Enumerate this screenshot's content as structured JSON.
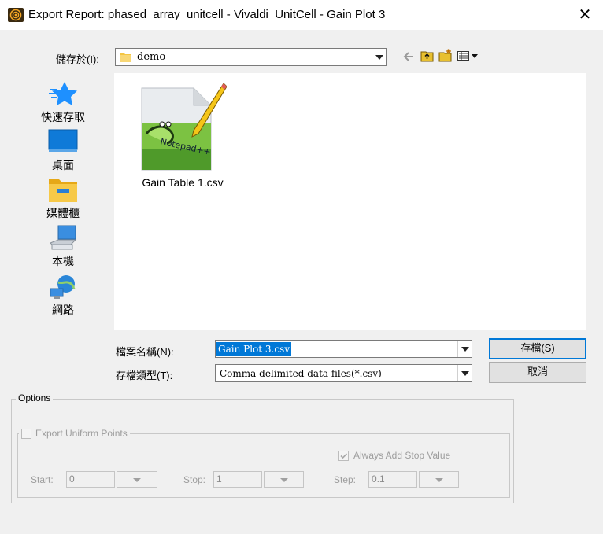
{
  "window": {
    "title": "Export Report: phased_array_unitcell - Vivaldi_UnitCell - Gain Plot 3",
    "close_glyph": "✕"
  },
  "save_in": {
    "label": "儲存於(I):",
    "value": "demo"
  },
  "places": [
    {
      "label": "快速存取",
      "icon": "star-icon"
    },
    {
      "label": "桌面",
      "icon": "desktop-icon"
    },
    {
      "label": "媒體櫃",
      "icon": "library-folder-icon"
    },
    {
      "label": "本機",
      "icon": "computer-icon"
    },
    {
      "label": "網路",
      "icon": "network-icon"
    }
  ],
  "files": [
    {
      "name": "Gain Table 1.csv",
      "icon": "notepad-plus-plus-icon"
    }
  ],
  "filename": {
    "label": "檔案名稱(N):",
    "value": "Gain Plot 3.csv"
  },
  "filetype": {
    "label": "存檔類型(T):",
    "value": "Comma delimited data files(*.csv)"
  },
  "buttons": {
    "save": "存檔(S)",
    "cancel": "取消"
  },
  "options": {
    "title": "Options",
    "uniform_points": {
      "label": "Export Uniform Points",
      "checked": false
    },
    "always_add_stop": {
      "label": "Always Add Stop Value",
      "checked": true
    },
    "start": {
      "label": "Start:",
      "value": "0"
    },
    "stop": {
      "label": "Stop:",
      "value": "1"
    },
    "step": {
      "label": "Step:",
      "value": "0.1"
    }
  },
  "colors": {
    "selection": "#0078d7",
    "accent_blue": "#1e88e5"
  }
}
